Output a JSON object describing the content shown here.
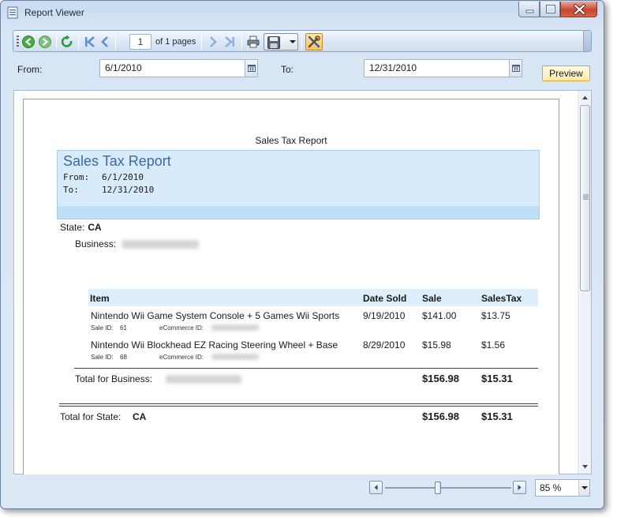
{
  "window": {
    "title": "Report Viewer"
  },
  "toolbar": {
    "page_number": "1",
    "of_pages": "of 1 pages"
  },
  "params": {
    "from_label": "From:",
    "from_value": "6/1/2010",
    "to_label": "To:",
    "to_value": "12/31/2010",
    "preview_label": "Preview"
  },
  "report": {
    "page_heading": "Sales Tax Report",
    "title": "Sales Tax Report",
    "from_label": "From:",
    "from_value": "6/1/2010",
    "to_label": "To:",
    "to_value": "12/31/2010",
    "state_label": "State:",
    "state_value": "CA",
    "business_label": "Business:",
    "columns": {
      "item": "Item",
      "date_sold": "Date Sold",
      "sale": "Sale",
      "sales_tax": "SalesTax"
    },
    "rows": [
      {
        "item": "Nintendo Wii Game System Console + 5 Games Wii Sports",
        "date_sold": "9/19/2010",
        "sale": "$141.00",
        "sales_tax": "$13.75",
        "sale_id_label": "Sale ID:",
        "sale_id": "61",
        "ecommerce_label": "eCommerce ID:"
      },
      {
        "item": "Nintendo Wii Blockhead EZ Racing Steering Wheel + Base",
        "date_sold": "8/29/2010",
        "sale": "$15.98",
        "sales_tax": "$1.56",
        "sale_id_label": "Sale ID:",
        "sale_id": "68",
        "ecommerce_label": "eCommerce ID:"
      }
    ],
    "business_total_label": "Total for Business:",
    "business_total_sale": "$156.98",
    "business_total_tax": "$15.31",
    "state_total_label": "Total for State:",
    "state_total_value": "CA",
    "state_total_sale": "$156.98",
    "state_total_tax": "$15.31"
  },
  "status": {
    "zoom": "85 %"
  },
  "icons": {
    "back": "back-icon",
    "forward": "forward-icon",
    "refresh": "refresh-icon",
    "first_page": "first-page-icon",
    "prev_page": "previous-page-icon",
    "next_page": "next-page-icon",
    "last_page": "last-page-icon",
    "print": "print-icon",
    "save": "save-icon",
    "tools": "tools-icon",
    "calendar": "calendar-icon"
  },
  "colors": {
    "accent_green": "#3aa53a",
    "nav_blue": "#6f9ad6",
    "header_band": "#d8ebfb",
    "title_blue": "#3d68a8",
    "preview_highlight": "#ffe8a3"
  }
}
